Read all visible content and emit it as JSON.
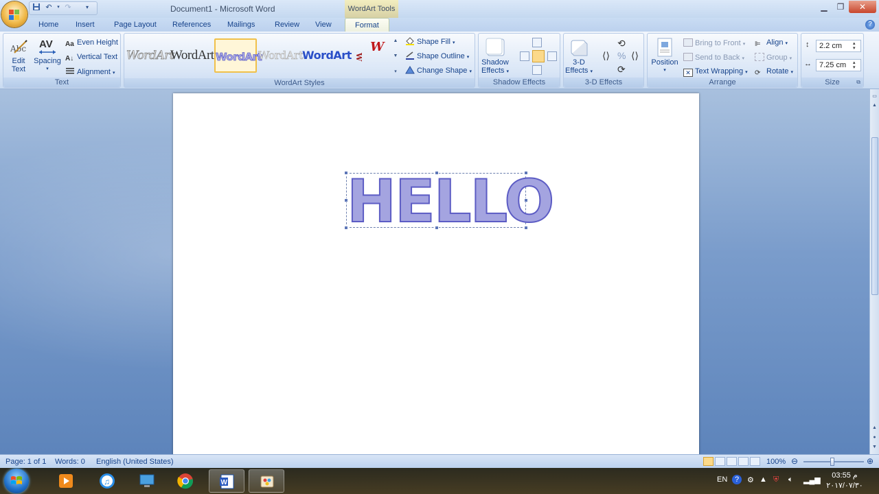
{
  "window": {
    "title": "Document1 - Microsoft Word",
    "context_tool": "WordArt Tools"
  },
  "tabs": [
    {
      "label": "Home"
    },
    {
      "label": "Insert"
    },
    {
      "label": "Page Layout"
    },
    {
      "label": "References"
    },
    {
      "label": "Mailings"
    },
    {
      "label": "Review"
    },
    {
      "label": "View"
    },
    {
      "label": "Format",
      "active": true
    }
  ],
  "ribbon": {
    "text_group": {
      "label": "Text",
      "edit_text_1": "Edit",
      "edit_text_2": "Text",
      "spacing": "Spacing",
      "even_height": "Even Height",
      "vertical_text": "Vertical Text",
      "alignment": "Alignment"
    },
    "wordart_styles": {
      "label": "WordArt Styles",
      "items": [
        "WordArt",
        "WordArt",
        "WordArt",
        "WordArt",
        "WordArt",
        "W",
        "W"
      ],
      "shape_fill": "Shape Fill",
      "shape_outline": "Shape Outline",
      "change_shape": "Change Shape"
    },
    "shadow_effects": {
      "label": "Shadow Effects",
      "btn_1": "Shadow",
      "btn_2": "Effects"
    },
    "effects_3d": {
      "label": "3-D Effects",
      "btn_1": "3-D",
      "btn_2": "Effects"
    },
    "arrange": {
      "label": "Arrange",
      "position": "Position",
      "bring_to_front": "Bring to Front",
      "send_to_back": "Send to Back",
      "text_wrapping": "Text Wrapping",
      "align": "Align",
      "group": "Group",
      "rotate": "Rotate"
    },
    "size": {
      "label": "Size",
      "height": "2.2 cm",
      "width": "7.25 cm"
    }
  },
  "document": {
    "wordart_text": "HELLO"
  },
  "status": {
    "page": "Page: 1 of 1",
    "words": "Words: 0",
    "language": "English (United States)",
    "zoom": "100%"
  },
  "taskbar": {
    "lang": "EN",
    "time": "03:55 م",
    "date": "٢٠١٧/٠٧/٣٠"
  },
  "colors": {
    "ribbon_text": "#15428b",
    "wordart_fill": "#a4a4e0",
    "wordart_outline": "#5c5cc4",
    "selection_gold": "#f0c04a"
  }
}
